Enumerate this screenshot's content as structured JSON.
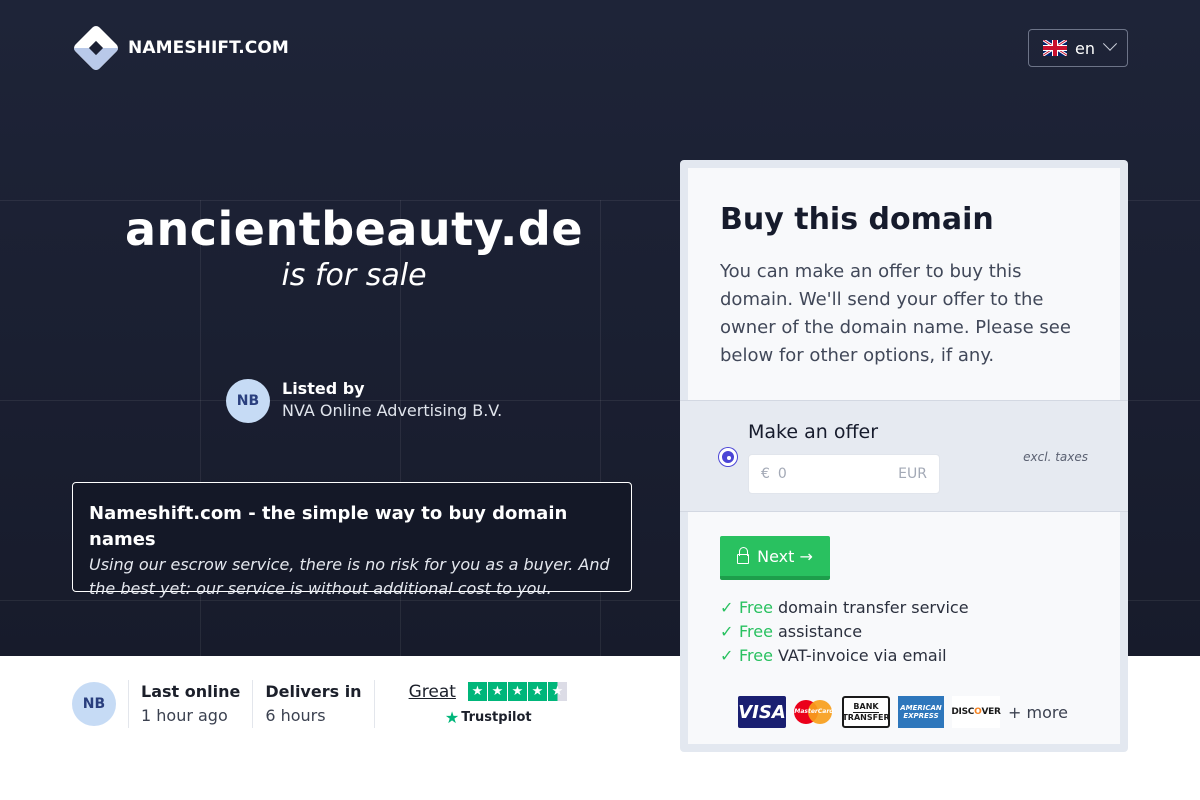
{
  "header": {
    "brand": "NAMESHIFT.COM",
    "language": "en"
  },
  "hero": {
    "domain": "ancientbeauty.de",
    "subtitle": "is for sale",
    "seller_initials": "NB",
    "listed_by_label": "Listed by",
    "listed_by_name": "NVA Online Advertising B.V."
  },
  "info": {
    "title": "Nameshift.com - the simple way to buy domain names",
    "body": "Using our escrow service, there is no risk for you as a buyer. And the best yet: our service is without additional cost to you."
  },
  "stats": {
    "initials": "NB",
    "last_online_label": "Last online",
    "last_online_value": "1 hour ago",
    "delivers_label": "Delivers in",
    "delivers_value": "6 hours",
    "rating_text": "Great",
    "rating_stars": 4.5,
    "trustpilot": "Trustpilot"
  },
  "card": {
    "title": "Buy this domain",
    "description": "You can make an offer to buy this domain. We'll send your offer to the owner of the domain name. Please see below for other options, if any.",
    "offer_label": "Make an offer",
    "excl_taxes": "excl. taxes",
    "currency_symbol": "€",
    "amount_placeholder": "0",
    "currency_code": "EUR",
    "next_label": "Next →",
    "free_word": "Free",
    "features": [
      "domain transfer service",
      "assistance",
      "VAT-invoice via email"
    ],
    "payments": {
      "visa": "VISA",
      "mastercard": "MasterCard",
      "bank_line1": "BANK",
      "bank_line2": "TRANSFER",
      "amex_line1": "AMERICAN",
      "amex_line2": "EXPRESS",
      "discover_a": "DISC",
      "discover_o": "O",
      "discover_b": "VER",
      "more": "+ more"
    }
  },
  "colors": {
    "hero_bg": "#1b2033",
    "accent_green": "#29c160",
    "radio_purple": "#4b45d6",
    "trustpilot_green": "#00b67a"
  }
}
